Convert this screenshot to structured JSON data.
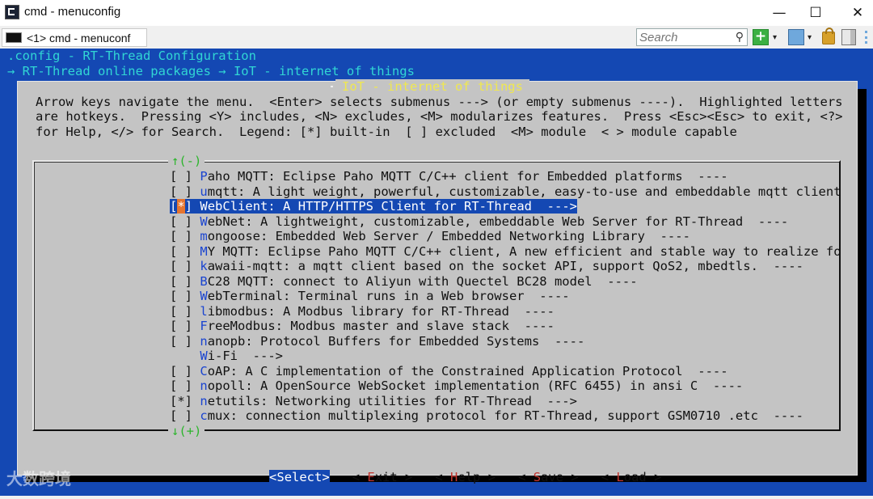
{
  "window": {
    "title": "cmd - menuconfig",
    "minimize": "—",
    "maximize": "☐",
    "close": "✕"
  },
  "toolbar": {
    "console_tab": "<1> cmd - menuconf",
    "search_placeholder": "Search",
    "add_label": "+",
    "dropdown_glyph": "▾"
  },
  "terminal": {
    "path_line1": ".config - RT-Thread Configuration",
    "path_line2": "→ RT-Thread online packages → IoT - internet of things"
  },
  "dialog": {
    "title": "IoT - internet of things",
    "help_line1": "Arrow keys navigate the menu.  <Enter> selects submenus ---> (or empty submenus ----).  Highlighted letters",
    "help_line2": "are hotkeys.  Pressing <Y> includes, <N> excludes, <M> modularizes features.  Press <Esc><Esc> to exit, <?>",
    "help_line3": "for Help, </> for Search.  Legend: [*] built-in  [ ] excluded  <M> module  < > module capable",
    "scroll_up": "↑(-)",
    "scroll_down": "↓(+)"
  },
  "menu_items": [
    {
      "box": "[ ]",
      "hot": "P",
      "rest": "aho MQTT: Eclipse Paho MQTT C/C++ client for Embedded platforms  ----",
      "selected": false
    },
    {
      "box": "[ ]",
      "hot": "u",
      "rest": "mqtt: A light weight, powerful, customizable, easy-to-use and embeddable mqtt client",
      "selected": false
    },
    {
      "box": "[*]",
      "hot": "W",
      "rest": "ebClient: A HTTP/HTTPS Client for RT-Thread  --->",
      "selected": true
    },
    {
      "box": "[ ]",
      "hot": "W",
      "rest": "ebNet: A lightweight, customizable, embeddable Web Server for RT-Thread  ----",
      "selected": false
    },
    {
      "box": "[ ]",
      "hot": "m",
      "rest": "ongoose: Embedded Web Server / Embedded Networking Library  ----",
      "selected": false
    },
    {
      "box": "[ ]",
      "hot": "M",
      "rest": "Y MQTT: Eclipse Paho MQTT C/C++ client, A new efficient and stable way to realize fo",
      "selected": false
    },
    {
      "box": "[ ]",
      "hot": "k",
      "rest": "awaii-mqtt: a mqtt client based on the socket API, support QoS2, mbedtls.  ----",
      "selected": false
    },
    {
      "box": "[ ]",
      "hot": "B",
      "rest": "C28 MQTT: connect to Aliyun with Quectel BC28 model  ----",
      "selected": false
    },
    {
      "box": "[ ]",
      "hot": "W",
      "rest": "ebTerminal: Terminal runs in a Web browser  ----",
      "selected": false
    },
    {
      "box": "[ ]",
      "hot": "l",
      "rest": "ibmodbus: A Modbus library for RT-Thread  ----",
      "selected": false
    },
    {
      "box": "[ ]",
      "hot": "F",
      "rest": "reeModbus: Modbus master and slave stack  ----",
      "selected": false
    },
    {
      "box": "[ ]",
      "hot": "n",
      "rest": "anopb: Protocol Buffers for Embedded Systems  ----",
      "selected": false
    },
    {
      "box": "   ",
      "hot": "W",
      "rest": "i-Fi  --->",
      "selected": false
    },
    {
      "box": "[ ]",
      "hot": "C",
      "rest": "oAP: A C implementation of the Constrained Application Protocol  ----",
      "selected": false
    },
    {
      "box": "[ ]",
      "hot": "n",
      "rest": "opoll: A OpenSource WebSocket implementation (RFC 6455) in ansi C  ----",
      "selected": false
    },
    {
      "box": "[*]",
      "hot": "n",
      "rest": "etutils: Networking utilities for RT-Thread  --->",
      "selected": false
    },
    {
      "box": "[ ]",
      "hot": "c",
      "rest": "mux: connection multiplexing protocol for RT-Thread, support GSM0710 .etc  ----",
      "selected": false
    }
  ],
  "buttons": {
    "select": {
      "pre": "<",
      "hot": "S",
      "post": "elect>"
    },
    "exit": {
      "pre": "< ",
      "hot": "E",
      "post": "xit >"
    },
    "help": {
      "pre": "< ",
      "hot": "H",
      "post": "elp >"
    },
    "save": {
      "pre": "< ",
      "hot": "S",
      "post": "ave >"
    },
    "load": {
      "pre": "< ",
      "hot": "L",
      "post": "oad >"
    }
  },
  "watermark": "大数跨境",
  "colors": {
    "terminal_bg": "#1448b3",
    "dialog_bg": "#c4c4c4",
    "title_yellow": "#f0e84f",
    "path_cyan": "#31d6d4",
    "hotkey_blue": "#1a44d0",
    "button_hotkey_red": "#c3342d",
    "scroll_green": "#2db52d"
  }
}
